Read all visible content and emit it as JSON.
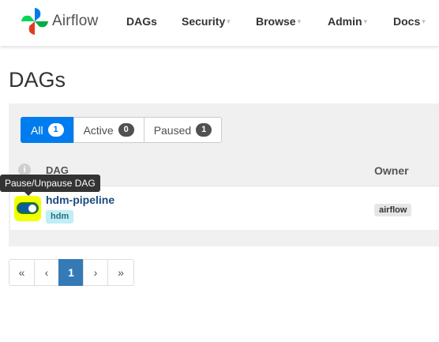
{
  "navbar": {
    "brand": "Airflow",
    "items": [
      {
        "label": "DAGs",
        "has_caret": false
      },
      {
        "label": "Security",
        "has_caret": true
      },
      {
        "label": "Browse",
        "has_caret": true
      },
      {
        "label": "Admin",
        "has_caret": true
      },
      {
        "label": "Docs",
        "has_caret": true
      }
    ],
    "caret_glyph": "▾"
  },
  "page": {
    "title": "DAGs"
  },
  "filters": [
    {
      "label": "All",
      "count": "1",
      "active": true
    },
    {
      "label": "Active",
      "count": "0",
      "active": false
    },
    {
      "label": "Paused",
      "count": "1",
      "active": false
    }
  ],
  "table": {
    "info_glyph": "i",
    "headers": {
      "dag": "DAG",
      "owner": "Owner"
    },
    "rows": [
      {
        "dag_id": "hdm-pipeline",
        "tag": "hdm",
        "owner": "airflow",
        "paused": false
      }
    ]
  },
  "tooltip": {
    "text": "Pause/Unpause DAG"
  },
  "pagination": {
    "first": "«",
    "prev": "‹",
    "current": "1",
    "next": "›",
    "last": "»"
  },
  "colors": {
    "accent": "#017cee",
    "pagination_active": "#337ab7",
    "toggle_on": "#0f5d9a",
    "highlight": "#f2ff00",
    "tag_bg": "#bfeef7"
  }
}
